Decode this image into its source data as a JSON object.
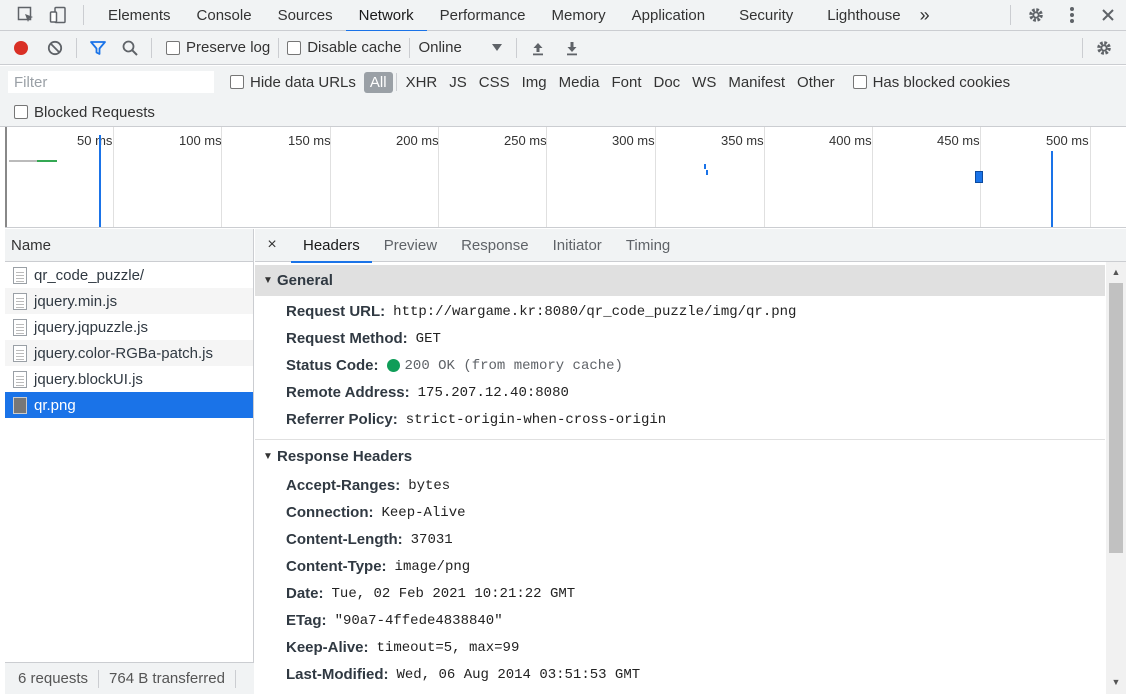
{
  "top_tabs": [
    "Elements",
    "Console",
    "Sources",
    "Network",
    "Performance",
    "Memory",
    "Application",
    "Security",
    "Lighthouse"
  ],
  "top_more": "»",
  "toolbar": {
    "preserve_log": "Preserve log",
    "disable_cache": "Disable cache",
    "throttling": "Online",
    "preserve_log_checked": false,
    "disable_cache_checked": false
  },
  "filter": {
    "placeholder": "Filter",
    "hide_data_urls": "Hide data URLs",
    "types": [
      "All",
      "XHR",
      "JS",
      "CSS",
      "Img",
      "Media",
      "Font",
      "Doc",
      "WS",
      "Manifest",
      "Other"
    ],
    "active_type": "All",
    "has_blocked_cookies": "Has blocked cookies",
    "blocked_requests": "Blocked Requests"
  },
  "overview": {
    "ticks": [
      "50 ms",
      "100 ms",
      "150 ms",
      "200 ms",
      "250 ms",
      "300 ms",
      "350 ms",
      "400 ms",
      "450 ms",
      "500 ms"
    ]
  },
  "request_list": {
    "header": "Name",
    "items": [
      {
        "name": "qr_code_puzzle/",
        "type": "doc"
      },
      {
        "name": "jquery.min.js",
        "type": "script"
      },
      {
        "name": "jquery.jqpuzzle.js",
        "type": "script"
      },
      {
        "name": "jquery.color-RGBa-patch.js",
        "type": "script"
      },
      {
        "name": "jquery.blockUI.js",
        "type": "script"
      },
      {
        "name": "qr.png",
        "type": "image",
        "selected": true
      }
    ],
    "summary": {
      "requests": "6 requests",
      "transferred": "764 B transferred"
    }
  },
  "details": {
    "close": "×",
    "tabs": [
      "Headers",
      "Preview",
      "Response",
      "Initiator",
      "Timing"
    ],
    "active_tab": "Headers",
    "general": {
      "title": "General",
      "rows": [
        {
          "key": "Request URL:",
          "value": "http://wargame.kr:8080/qr_code_puzzle/img/qr.png"
        },
        {
          "key": "Request Method:",
          "value": "GET"
        },
        {
          "key": "Status Code:",
          "value": "200 OK (from memory cache)",
          "status_color": "#0f9d58"
        },
        {
          "key": "Remote Address:",
          "value": "175.207.12.40:8080"
        },
        {
          "key": "Referrer Policy:",
          "value": "strict-origin-when-cross-origin"
        }
      ]
    },
    "response_headers": {
      "title": "Response Headers",
      "rows": [
        {
          "key": "Accept-Ranges:",
          "value": "bytes"
        },
        {
          "key": "Connection:",
          "value": "Keep-Alive"
        },
        {
          "key": "Content-Length:",
          "value": "37031"
        },
        {
          "key": "Content-Type:",
          "value": "image/png"
        },
        {
          "key": "Date:",
          "value": "Tue, 02 Feb 2021 10:21:22 GMT"
        },
        {
          "key": "ETag:",
          "value": "\"90a7-4ffede4838840\""
        },
        {
          "key": "Keep-Alive:",
          "value": "timeout=5, max=99"
        },
        {
          "key": "Last-Modified:",
          "value": "Wed, 06 Aug 2014 03:51:53 GMT"
        }
      ]
    }
  },
  "colors": {
    "accent": "#1a73e8",
    "record": "#d93025",
    "status_ok": "#0f9d58"
  }
}
